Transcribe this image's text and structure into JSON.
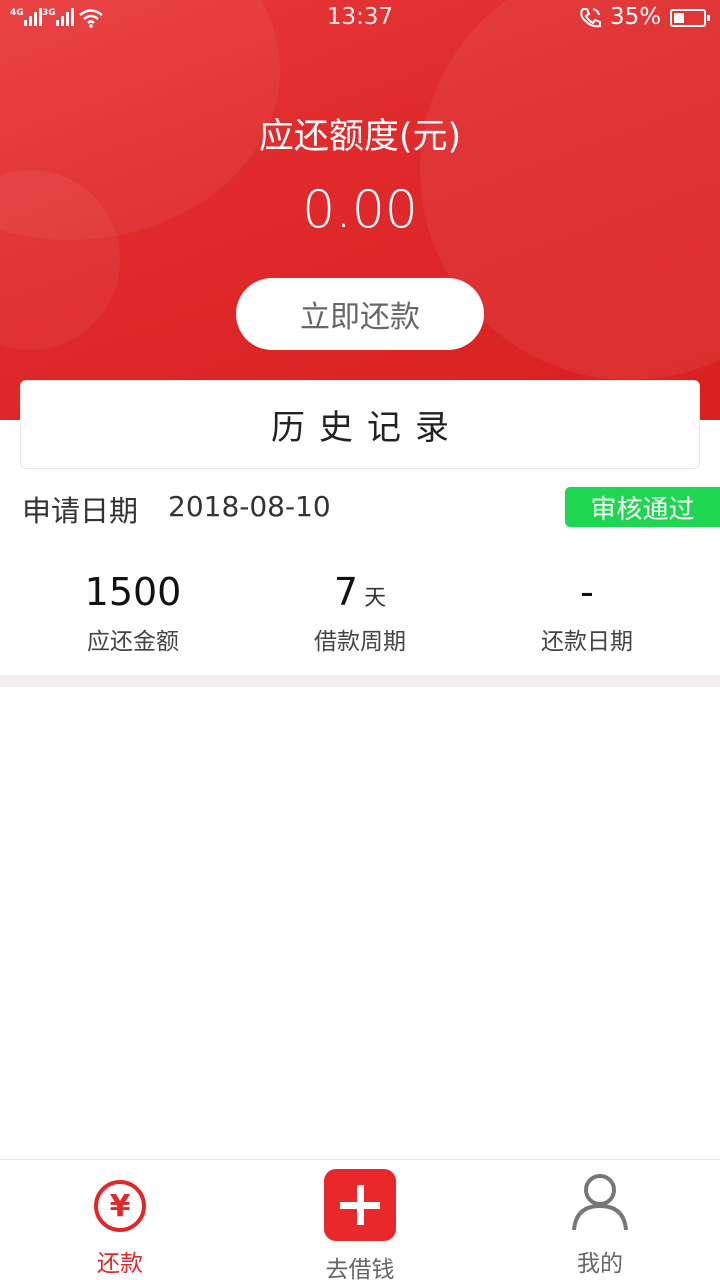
{
  "status_bar": {
    "net1": "4G",
    "net2": "3G",
    "time": "13:37",
    "battery_pct": "35%",
    "battery_level": 0.35
  },
  "hero": {
    "title": "应还额度(元)",
    "amount": "0.00",
    "repay_button": "立即还款"
  },
  "history": {
    "title": "历史记录"
  },
  "record": {
    "apply_label": "申请日期",
    "apply_date": "2018-08-10",
    "status": "审核通过",
    "amount_value": "1500",
    "amount_label": "应还金额",
    "period_value": "7",
    "period_unit": "天",
    "period_label": "借款周期",
    "repay_date_value": "-",
    "repay_date_label": "还款日期"
  },
  "tabbar": {
    "repay": "还款",
    "borrow": "去借钱",
    "mine": "我的"
  },
  "colors": {
    "brand_red": "#e0282a",
    "approved_green": "#1fd652"
  },
  "icons": {
    "repay": "yen-circle-icon",
    "borrow": "plus-square-icon",
    "mine": "person-icon"
  }
}
